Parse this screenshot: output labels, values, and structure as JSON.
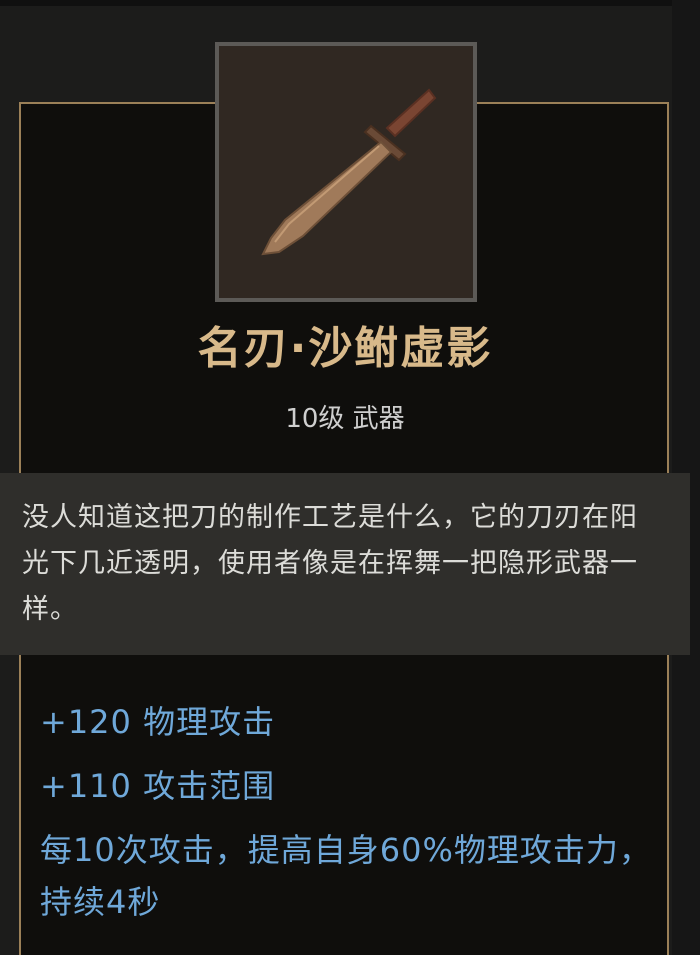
{
  "item": {
    "name": "名刃·沙鲋虚影",
    "level_type": "10级 武器",
    "icon": "blade-icon"
  },
  "lore": {
    "text": "没人知道这把刀的制作工艺是什么，它的刀刃在阳光下几近透明，使用者像是在挥舞一把隐形武器一样。"
  },
  "stats": {
    "line1": "+120 物理攻击",
    "line2": "+110 攻击范围",
    "effect": "每10次攻击，提高自身60%物理攻击力，持续4秒"
  },
  "colors": {
    "name": "#d8b98a",
    "stat": "#6fa8d9",
    "border": "#9b8058",
    "lore_bg": "#2f2e2b"
  }
}
